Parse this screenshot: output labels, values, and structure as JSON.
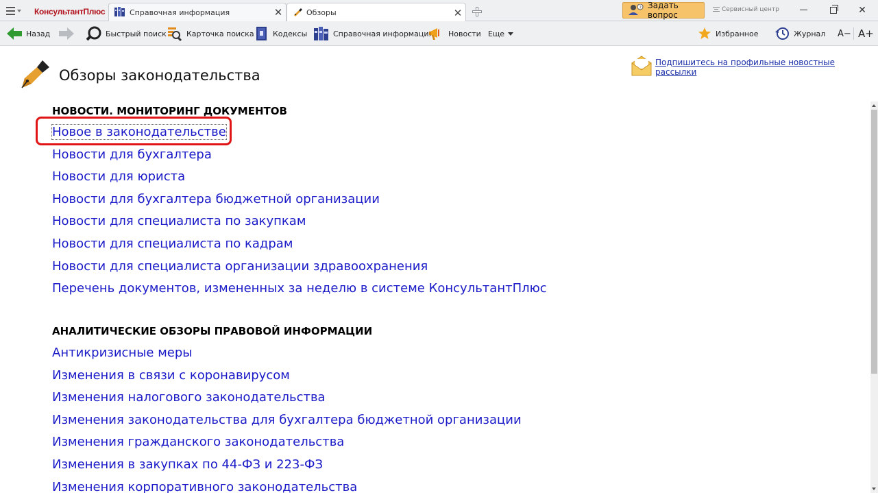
{
  "window": {
    "brand": "КонсультантПлюс",
    "tabs": [
      {
        "label": "Справочная информация",
        "icon": "books-icon"
      },
      {
        "label": "Обзоры",
        "icon": "pen-icon"
      }
    ],
    "ask_label": "Задать вопрос",
    "service_label": "Сервисный центр"
  },
  "toolbar": {
    "back": "Назад",
    "quick_search": "Быстрый поиск",
    "search_card": "Карточка поиска",
    "codexes": "Кодексы",
    "reference": "Справочная информация",
    "news": "Новости",
    "more": "Еще",
    "favorites": "Избранное",
    "journal": "Журнал",
    "font_decrease": "A−",
    "font_increase": "A+"
  },
  "page": {
    "title": "Обзоры законодательства",
    "subscribe_link": "Подпишитесь на профильные новостные рассылки",
    "sections": [
      {
        "title": "НОВОСТИ. МОНИТОРИНГ ДОКУМЕНТОВ",
        "items": [
          "Новое в законодательстве",
          "Новости для бухгалтера",
          "Новости для юриста",
          "Новости для бухгалтера бюджетной организации",
          "Новости для специалиста по закупкам",
          "Новости для специалиста по кадрам",
          "Новости для специалиста организации здравоохранения",
          "Перечень документов, измененных за неделю в системе КонсультантПлюс"
        ]
      },
      {
        "title": "АНАЛИТИЧЕСКИЕ ОБЗОРЫ ПРАВОВОЙ ИНФОРМАЦИИ",
        "items": [
          "Антикризисные меры",
          "Изменения в связи с коронавирусом",
          "Изменения налогового законодательства",
          "Изменения законодательства для бухгалтера бюджетной организации",
          "Изменения гражданского законодательства",
          "Изменения в закупках по 44-ФЗ и 223-ФЗ",
          "Изменения корпоративного законодательства"
        ]
      }
    ]
  },
  "colors": {
    "link": "#1a1ac8",
    "highlight": "#e01414",
    "brand": "#b3131e",
    "ask_button": "#f6c36b"
  }
}
